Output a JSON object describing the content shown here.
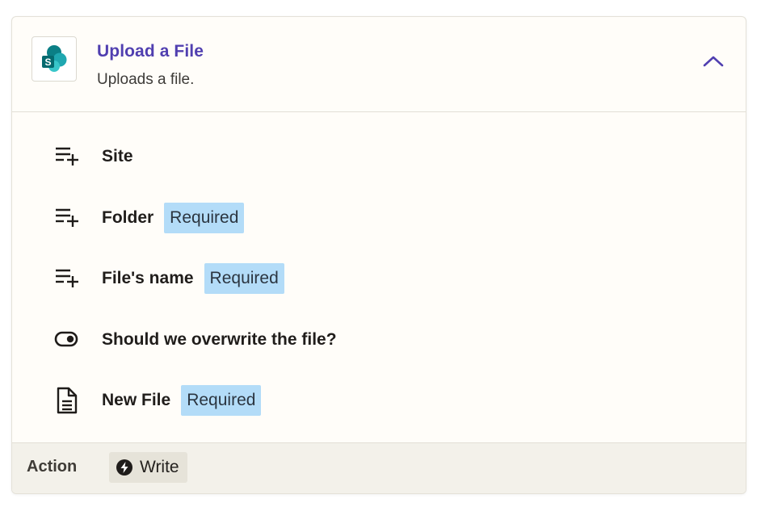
{
  "step": {
    "title": "Upload a File",
    "description": "Uploads a file.",
    "app_icon": "sharepoint-logo",
    "collapse_icon": "chevron-up-icon",
    "accent_color": "#503fb0"
  },
  "fields": [
    {
      "label": "Site",
      "required": false,
      "icon": "add-list-icon"
    },
    {
      "label": "Folder",
      "required": true,
      "icon": "add-list-icon"
    },
    {
      "label": "File's name",
      "required": true,
      "icon": "add-list-icon"
    },
    {
      "label": "Should we overwrite the file?",
      "required": false,
      "icon": "toggle-icon"
    },
    {
      "label": "New File",
      "required": true,
      "icon": "document-icon"
    }
  ],
  "required_badge_label": "Required",
  "required_badge_color": "#b3dcf8",
  "footer": {
    "label": "Action",
    "type_label": "Write",
    "type_icon": "lightning-bolt-icon"
  }
}
